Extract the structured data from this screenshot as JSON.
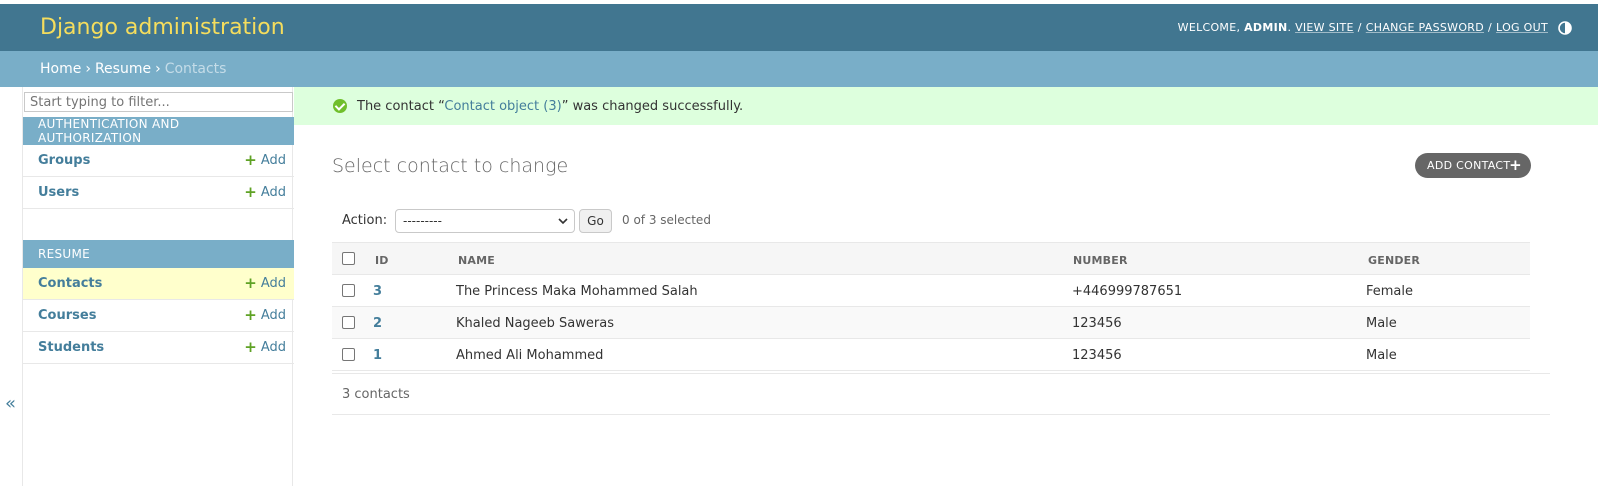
{
  "header": {
    "site_name": "Django administration",
    "welcome": "WELCOME,",
    "username": "ADMIN",
    "view_site": "VIEW SITE",
    "change_password": "CHANGE PASSWORD",
    "log_out": "LOG OUT",
    "theme_icon": "contrast-icon"
  },
  "breadcrumbs": {
    "home": "Home",
    "app": "Resume",
    "current": "Contacts",
    "separator": "›"
  },
  "sidebar": {
    "filter_placeholder": "Start typing to filter...",
    "modules": [
      {
        "caption": "Authentication and Authorization",
        "models": [
          {
            "name": "Groups",
            "add": "Add"
          },
          {
            "name": "Users",
            "add": "Add"
          }
        ]
      },
      {
        "caption": "Resume",
        "models": [
          {
            "name": "Contacts",
            "add": "Add",
            "current": true
          },
          {
            "name": "Courses",
            "add": "Add"
          },
          {
            "name": "Students",
            "add": "Add"
          }
        ]
      }
    ],
    "collapse_glyph": "«"
  },
  "message": {
    "prefix": "The contact “",
    "link": "Contact object (3)",
    "suffix": "” was changed successfully."
  },
  "content": {
    "title": "Select contact to change",
    "add_button": "ADD CONTACT",
    "actions_label": "Action:",
    "action_selected": "---------",
    "go_label": "Go",
    "counter": "0 of 3 selected",
    "columns": [
      "ID",
      "NAME",
      "NUMBER",
      "GENDER"
    ],
    "rows": [
      {
        "id": "3",
        "name": "The Princess Maka Mohammed Salah",
        "number": "+446999787651",
        "gender": "Female"
      },
      {
        "id": "2",
        "name": "Khaled Nageeb Saweras",
        "number": "123456",
        "gender": "Male"
      },
      {
        "id": "1",
        "name": "Ahmed Ali Mohammed",
        "number": "123456",
        "gender": "Male"
      }
    ],
    "paginator": "3 contacts"
  },
  "colors": {
    "header_bg": "#417690",
    "site_name": "#f5dd5d",
    "breadcrumbs_bg": "#79aec8",
    "link": "#447e9b",
    "success_bg": "#ddffdd",
    "add_green": "#5fa225",
    "current_row": "#ffffcc"
  }
}
